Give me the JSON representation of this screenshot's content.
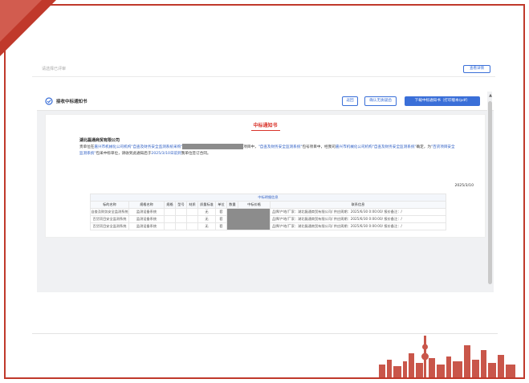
{
  "top_bar": {
    "hint": "请选择已评审",
    "button": "查看详情"
  },
  "modal": {
    "title": "接收中标通知书",
    "buttons": {
      "back": "返回",
      "confirm": "确认无质疑函",
      "download": "下载中标通知书（打印版本/pdf）"
    }
  },
  "notice": {
    "title": "中标通知书",
    "addressee": "湖北磊通商贸有限公司",
    "p_intro": "贵单位在",
    "p_org1": "嘉兴市机械化公司机构",
    "p_quote1": "\"自查及财务安全监测系统采购\"",
    "p_mid1": "项目中，",
    "p_proj1": "\"自查及财务安全监测系统\"",
    "p_mid2": "包号项目中，经我司",
    "p_org2": "嘉兴市机械化公司机构",
    "p_quote2": "\"自查及财务安全监测系统\"",
    "p_mid3": "确定，为",
    "p_proj2": "\"百货项目安全监测系统\"",
    "p_mid4": "包采中标单位，请收到此通知后于",
    "p_deadline": "2025/3/10日前到",
    "p_end": "我单位签订合同。",
    "date": "2025/3/10",
    "table": {
      "caption": "中标明细信息",
      "headers": [
        "标的名称",
        "规格名称",
        "规格",
        "型号",
        "材质",
        "质量标准",
        "单位",
        "数量",
        "中标价格",
        "联系信息"
      ],
      "rows": [
        [
          "自查及财务安全监测系统",
          "监测设备系统",
          "",
          "",
          "",
          "无",
          "套",
          "",
          "",
          "品牌/产地/厂家：湖北磊通商贸有限公司/ 供应周期：2025/6/30 0:00:00/ 报价备注：/"
        ],
        [
          "百货项目安全监测系统",
          "监测设备系统",
          "",
          "",
          "",
          "无",
          "套",
          "",
          "",
          "品牌/产地/厂家：湖北磊通商贸有限公司/ 供应周期：2025/6/30 0:00:00/ 报价备注：/"
        ],
        [
          "百货项目安全监测系统",
          "监测设备系统",
          "",
          "",
          "",
          "无",
          "套",
          "",
          "",
          "品牌/产地/厂家：湖北磊通商贸有限公司/ 供应周期：2025/6/30 0:00:00/ 报价备注：/"
        ]
      ]
    }
  },
  "colors": {
    "accent_red": "#c0392b",
    "primary_blue": "#3a6fd8",
    "mask_gray": "#8c8c8c"
  }
}
